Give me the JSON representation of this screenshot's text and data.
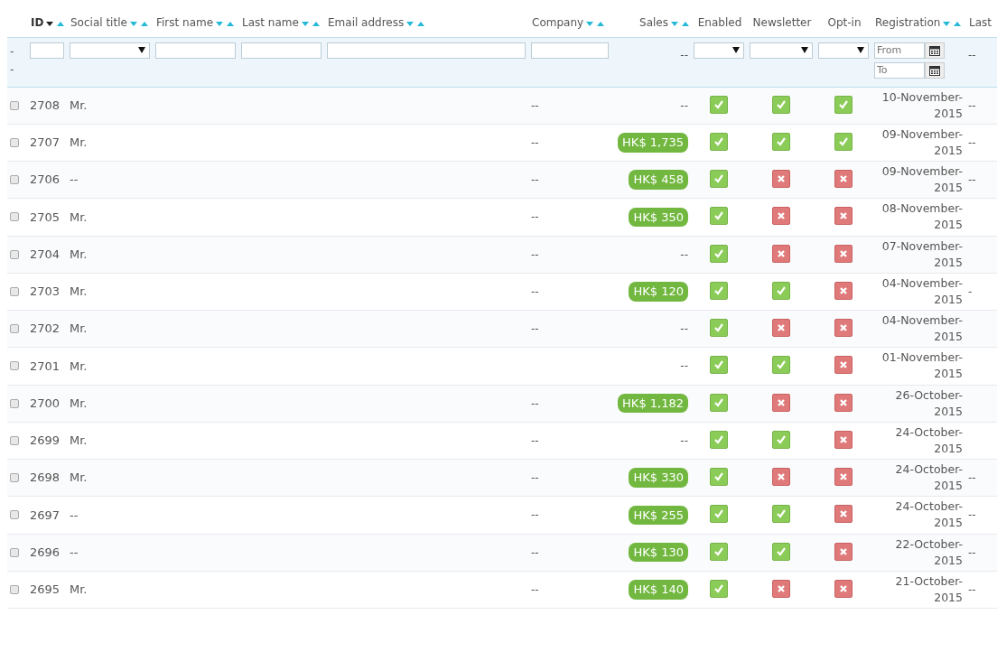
{
  "columns": [
    {
      "label": "ID",
      "sortable": true,
      "sorted": true
    },
    {
      "label": "Social title",
      "sortable": true,
      "sorted": false
    },
    {
      "label": "First name",
      "sortable": true,
      "sorted": false
    },
    {
      "label": "Last name",
      "sortable": true,
      "sorted": false
    },
    {
      "label": "Email address",
      "sortable": true,
      "sorted": false
    },
    {
      "label": "Company",
      "sortable": true,
      "sorted": false
    },
    {
      "label": "Sales",
      "sortable": true,
      "sorted": false
    },
    {
      "label": "Enabled",
      "sortable": false,
      "sorted": false
    },
    {
      "label": "Newsletter",
      "sortable": false,
      "sorted": false
    },
    {
      "label": "Opt-in",
      "sortable": false,
      "sorted": false
    },
    {
      "label": "Registration",
      "sortable": true,
      "sorted": false
    },
    {
      "label": "Last",
      "sortable": false,
      "sorted": false
    }
  ],
  "filters": [
    {
      "kind": "dashes",
      "texts": [
        "-",
        "-"
      ]
    },
    {
      "kind": "text"
    },
    {
      "kind": "select"
    },
    {
      "kind": "text"
    },
    {
      "kind": "text"
    },
    {
      "kind": "text"
    },
    {
      "kind": "text"
    },
    {
      "kind": "dash",
      "text": "--"
    },
    {
      "kind": "select"
    },
    {
      "kind": "select"
    },
    {
      "kind": "select"
    },
    {
      "kind": "date",
      "from_placeholder": "From",
      "to_placeholder": "To"
    },
    {
      "kind": "dash",
      "text": "--"
    }
  ],
  "rows": [
    {
      "checked": false,
      "id": "2708",
      "title": "Mr.",
      "company": "--",
      "sales": {
        "kind": "plain",
        "text": "--"
      },
      "enabled": true,
      "newsletter": true,
      "optin": true,
      "registration": "10-November-2015",
      "last": "--"
    },
    {
      "checked": false,
      "id": "2707",
      "title": "Mr.",
      "company": "--",
      "sales": {
        "kind": "badge",
        "text": "HK$ 1,735"
      },
      "enabled": true,
      "newsletter": true,
      "optin": true,
      "registration": "09-November-2015",
      "last": "--"
    },
    {
      "checked": false,
      "id": "2706",
      "title": "--",
      "company": "--",
      "sales": {
        "kind": "badge",
        "text": "HK$ 458"
      },
      "enabled": true,
      "newsletter": false,
      "optin": false,
      "registration": "09-November-2015",
      "last": "--"
    },
    {
      "checked": false,
      "id": "2705",
      "title": "Mr.",
      "company": "--",
      "sales": {
        "kind": "badge",
        "text": "HK$ 350"
      },
      "enabled": true,
      "newsletter": false,
      "optin": false,
      "registration": "08-November-2015"
    },
    {
      "checked": false,
      "id": "2704",
      "title": "Mr.",
      "company": "--",
      "sales": {
        "kind": "plain",
        "text": "--"
      },
      "enabled": true,
      "newsletter": false,
      "optin": false,
      "registration": "07-November-2015"
    },
    {
      "checked": false,
      "id": "2703",
      "title": "Mr.",
      "company": "--",
      "sales": {
        "kind": "badge",
        "text": "HK$ 120"
      },
      "enabled": true,
      "newsletter": true,
      "optin": false,
      "registration": "04-November-2015",
      "last": "-"
    },
    {
      "checked": false,
      "id": "2702",
      "title": "Mr.",
      "company": "--",
      "sales": {
        "kind": "plain",
        "text": "--"
      },
      "enabled": true,
      "newsletter": false,
      "optin": false,
      "registration": "04-November-2015"
    },
    {
      "checked": false,
      "id": "2701",
      "title": "Mr.",
      "sales": {
        "kind": "plain",
        "text": "--"
      },
      "enabled": true,
      "newsletter": true,
      "optin": false,
      "registration": "01-November-2015"
    },
    {
      "checked": false,
      "id": "2700",
      "title": "Mr.",
      "company": "--",
      "sales": {
        "kind": "badge",
        "text": "HK$ 1,182"
      },
      "enabled": true,
      "newsletter": false,
      "optin": false,
      "registration": "26-October-2015"
    },
    {
      "checked": false,
      "id": "2699",
      "title": "Mr.",
      "company": "--",
      "sales": {
        "kind": "plain",
        "text": "--"
      },
      "enabled": true,
      "newsletter": true,
      "optin": false,
      "registration": "24-October-2015"
    },
    {
      "checked": false,
      "id": "2698",
      "title": "Mr.",
      "company": "--",
      "sales": {
        "kind": "badge",
        "text": "HK$ 330"
      },
      "enabled": true,
      "newsletter": false,
      "optin": false,
      "registration": "24-October-2015",
      "last": "--"
    },
    {
      "checked": false,
      "id": "2697",
      "title": "--",
      "company": "--",
      "sales": {
        "kind": "badge",
        "text": "HK$ 255"
      },
      "enabled": true,
      "newsletter": true,
      "optin": false,
      "registration": "24-October-2015",
      "last": "--"
    },
    {
      "checked": false,
      "id": "2696",
      "title": "--",
      "company": "--",
      "sales": {
        "kind": "badge",
        "text": "HK$ 130"
      },
      "enabled": true,
      "newsletter": true,
      "optin": false,
      "registration": "22-October-2015",
      "last": "--"
    },
    {
      "checked": false,
      "id": "2695",
      "title": "Mr.",
      "company": "--",
      "sales": {
        "kind": "badge",
        "text": "HK$ 140"
      },
      "enabled": true,
      "newsletter": false,
      "optin": false,
      "registration": "21-October-2015",
      "last": "--"
    }
  ]
}
